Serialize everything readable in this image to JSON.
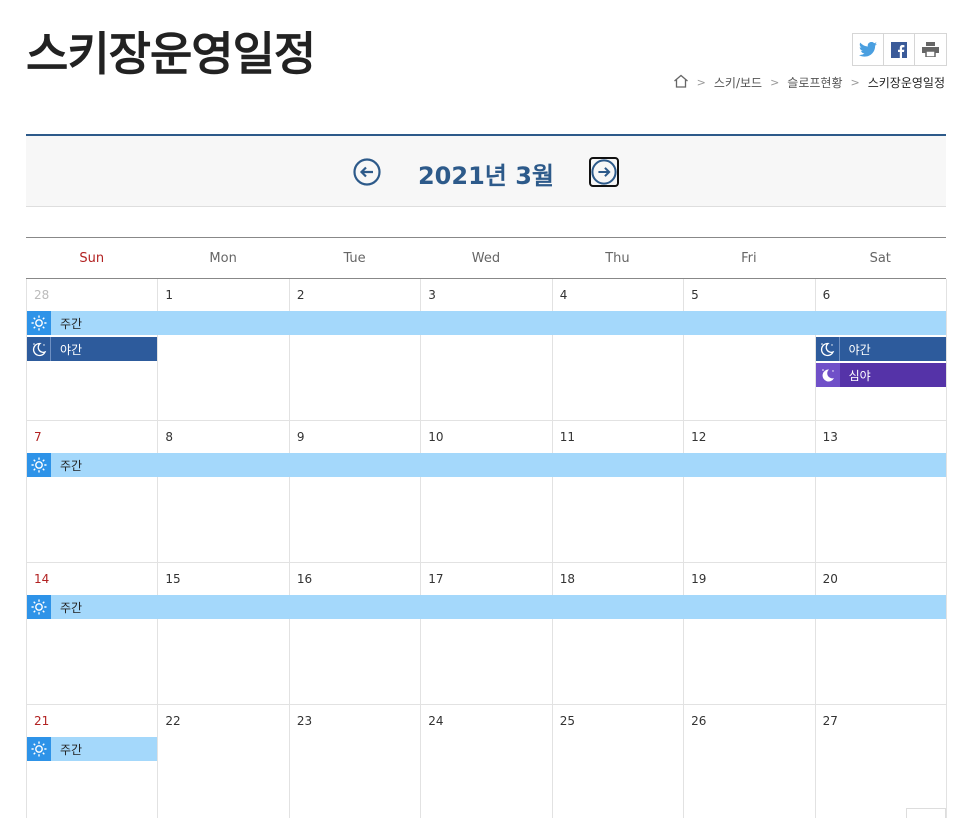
{
  "page": {
    "title": "스키장운영일정"
  },
  "share": {
    "twitter": "twitter-icon",
    "facebook": "facebook-icon",
    "print": "print-icon"
  },
  "breadcrumb": {
    "home_icon": "home-icon",
    "items": [
      "스키/보드",
      "슬로프현황",
      "스키장운영일정"
    ],
    "separator": ">"
  },
  "calendar": {
    "month_label": "2021년 3월",
    "weekdays": [
      "Sun",
      "Mon",
      "Tue",
      "Wed",
      "Thu",
      "Fri",
      "Sat"
    ],
    "weeks": [
      [
        "28",
        "1",
        "2",
        "3",
        "4",
        "5",
        "6"
      ],
      [
        "7",
        "8",
        "9",
        "10",
        "11",
        "12",
        "13"
      ],
      [
        "14",
        "15",
        "16",
        "17",
        "18",
        "19",
        "20"
      ],
      [
        "21",
        "22",
        "23",
        "24",
        "25",
        "26",
        "27"
      ]
    ],
    "events": {
      "day": "주간",
      "night": "야간",
      "late_night": "심야"
    }
  },
  "colors": {
    "accent": "#2d5a8a",
    "sunday": "#b22222",
    "day_event": "#a4d8fb",
    "night_event": "#2d5b9c",
    "late_night_event": "#5533a8"
  }
}
